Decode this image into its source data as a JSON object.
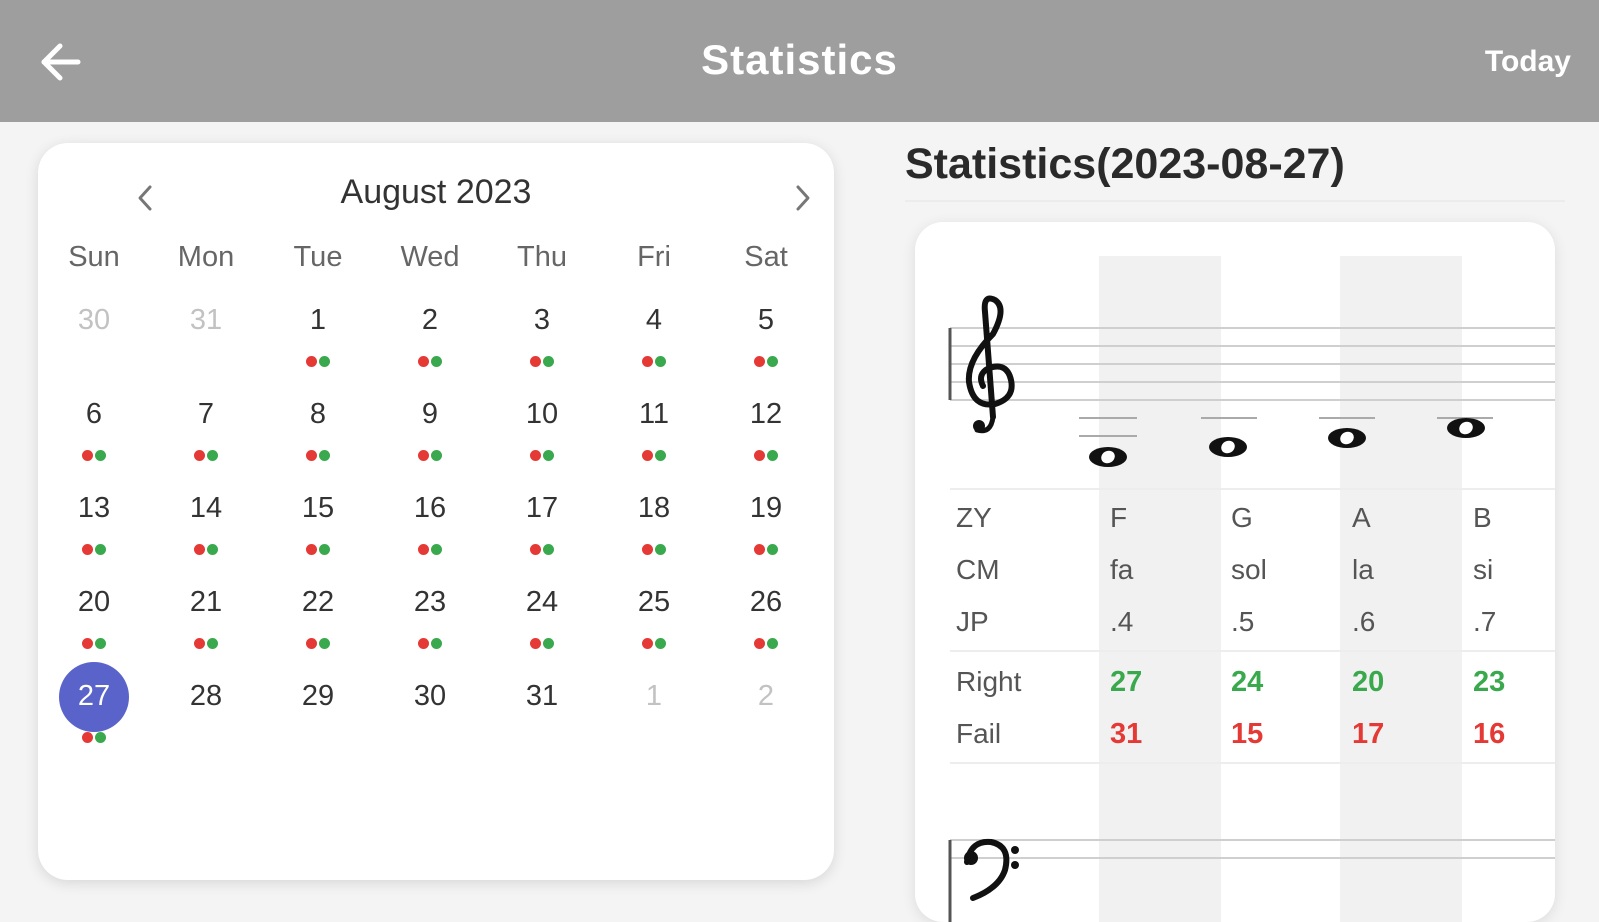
{
  "topbar": {
    "title": "Statistics",
    "back_icon": "arrow-left-icon",
    "today_label": "Today"
  },
  "calendar": {
    "month_title": "August 2023",
    "prev_icon": "chevron-left-icon",
    "next_icon": "chevron-right-icon",
    "weekdays": [
      "Sun",
      "Mon",
      "Tue",
      "Wed",
      "Thu",
      "Fri",
      "Sat"
    ],
    "weeks": [
      [
        {
          "n": "30",
          "muted": true,
          "dots": false
        },
        {
          "n": "31",
          "muted": true,
          "dots": false
        },
        {
          "n": "1",
          "muted": false,
          "dots": true
        },
        {
          "n": "2",
          "muted": false,
          "dots": true
        },
        {
          "n": "3",
          "muted": false,
          "dots": true
        },
        {
          "n": "4",
          "muted": false,
          "dots": true
        },
        {
          "n": "5",
          "muted": false,
          "dots": true
        }
      ],
      [
        {
          "n": "6",
          "muted": false,
          "dots": true
        },
        {
          "n": "7",
          "muted": false,
          "dots": true
        },
        {
          "n": "8",
          "muted": false,
          "dots": true
        },
        {
          "n": "9",
          "muted": false,
          "dots": true
        },
        {
          "n": "10",
          "muted": false,
          "dots": true
        },
        {
          "n": "11",
          "muted": false,
          "dots": true
        },
        {
          "n": "12",
          "muted": false,
          "dots": true
        }
      ],
      [
        {
          "n": "13",
          "muted": false,
          "dots": true
        },
        {
          "n": "14",
          "muted": false,
          "dots": true
        },
        {
          "n": "15",
          "muted": false,
          "dots": true
        },
        {
          "n": "16",
          "muted": false,
          "dots": true
        },
        {
          "n": "17",
          "muted": false,
          "dots": true
        },
        {
          "n": "18",
          "muted": false,
          "dots": true
        },
        {
          "n": "19",
          "muted": false,
          "dots": true
        }
      ],
      [
        {
          "n": "20",
          "muted": false,
          "dots": true
        },
        {
          "n": "21",
          "muted": false,
          "dots": true
        },
        {
          "n": "22",
          "muted": false,
          "dots": true
        },
        {
          "n": "23",
          "muted": false,
          "dots": true
        },
        {
          "n": "24",
          "muted": false,
          "dots": true
        },
        {
          "n": "25",
          "muted": false,
          "dots": true
        },
        {
          "n": "26",
          "muted": false,
          "dots": true
        }
      ],
      [
        {
          "n": "27",
          "muted": false,
          "dots": true,
          "selected": true
        },
        {
          "n": "28",
          "muted": false,
          "dots": false
        },
        {
          "n": "29",
          "muted": false,
          "dots": false
        },
        {
          "n": "30",
          "muted": false,
          "dots": false
        },
        {
          "n": "31",
          "muted": false,
          "dots": false
        },
        {
          "n": "1",
          "muted": true,
          "dots": false
        },
        {
          "n": "2",
          "muted": true,
          "dots": false
        }
      ]
    ],
    "colors": {
      "selected": "#5a63c9",
      "dot_red": "#e53935",
      "dot_green": "#3aa94d"
    }
  },
  "stats": {
    "title": "Statistics(2023-08-27)",
    "treble_clef_icon": "treble-clef-icon",
    "bass_clef_icon": "bass-clef-icon",
    "row_labels": {
      "zy": "ZY",
      "cm": "CM",
      "jp": "JP",
      "right": "Right",
      "fail": "Fail"
    },
    "notes": [
      {
        "zy": "F",
        "cm": "fa",
        "jp": ".4",
        "right": "27",
        "fail": "31"
      },
      {
        "zy": "G",
        "cm": "sol",
        "jp": ".5",
        "right": "24",
        "fail": "15"
      },
      {
        "zy": "A",
        "cm": "la",
        "jp": ".6",
        "right": "20",
        "fail": "17"
      },
      {
        "zy": "B",
        "cm": "si",
        "jp": ".7",
        "right": "23",
        "fail": "16"
      }
    ],
    "colors": {
      "right": "#3aa94d",
      "fail": "#e53935"
    }
  }
}
